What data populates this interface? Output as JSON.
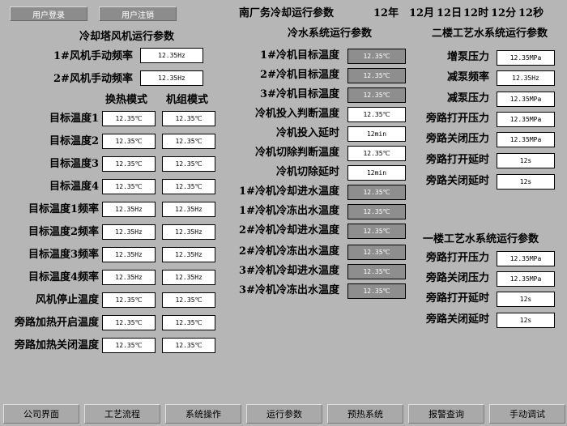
{
  "top_buttons": {
    "login": "用户登录",
    "logout": "用户注销"
  },
  "title": "南厂务冷却运行参数",
  "datetime": {
    "year": "12年",
    "month": "12月",
    "day": "12日",
    "hour": "12时",
    "minute": "12分",
    "second": "12秒"
  },
  "cooling_tower": {
    "title": "冷却塔风机运行参数",
    "fan1_label": "1#风机手动频率",
    "fan1_value": "12.35Hz",
    "fan2_label": "2#风机手动频率",
    "fan2_value": "12.35Hz",
    "col_heat": "换热模式",
    "col_unit": "机组模式",
    "rows": [
      {
        "label": "目标温度1",
        "heat": "12.35℃",
        "unit": "12.35℃"
      },
      {
        "label": "目标温度2",
        "heat": "12.35℃",
        "unit": "12.35℃"
      },
      {
        "label": "目标温度3",
        "heat": "12.35℃",
        "unit": "12.35℃"
      },
      {
        "label": "目标温度4",
        "heat": "12.35℃",
        "unit": "12.35℃"
      },
      {
        "label": "目标温度1频率",
        "heat": "12.35Hz",
        "unit": "12.35Hz"
      },
      {
        "label": "目标温度2频率",
        "heat": "12.35Hz",
        "unit": "12.35Hz"
      },
      {
        "label": "目标温度3频率",
        "heat": "12.35Hz",
        "unit": "12.35Hz"
      },
      {
        "label": "目标温度4频率",
        "heat": "12.35Hz",
        "unit": "12.35Hz"
      },
      {
        "label": "风机停止温度",
        "heat": "12.35℃",
        "unit": "12.35℃"
      },
      {
        "label": "旁路加热开启温度",
        "heat": "12.35℃",
        "unit": "12.35℃"
      },
      {
        "label": "旁路加热关闭温度",
        "heat": "12.35℃",
        "unit": "12.35℃"
      }
    ]
  },
  "chilled_water": {
    "title": "冷水系统运行参数",
    "rows": [
      {
        "label": "1#冷机目标温度",
        "value": "12.35℃"
      },
      {
        "label": "2#冷机目标温度",
        "value": "12.35℃"
      },
      {
        "label": "3#冷机目标温度",
        "value": "12.35℃"
      },
      {
        "label": "冷机投入判断温度",
        "value": "12.35℃"
      },
      {
        "label": "冷机投入延时",
        "value": "12min"
      },
      {
        "label": "冷机切除判断温度",
        "value": "12.35℃"
      },
      {
        "label": "冷机切除延时",
        "value": "12min"
      },
      {
        "label": "1#冷机冷却进水温度",
        "value": "12.35℃"
      },
      {
        "label": "1#冷机冷冻出水温度",
        "value": "12.35℃"
      },
      {
        "label": "2#冷机冷却进水温度",
        "value": "12.35℃"
      },
      {
        "label": "2#冷机冷冻出水温度",
        "value": "12.35℃"
      },
      {
        "label": "3#冷机冷却进水温度",
        "value": "12.35℃"
      },
      {
        "label": "3#冷机冷冻出水温度",
        "value": "12.35℃"
      }
    ]
  },
  "process2": {
    "title": "二楼工艺水系统运行参数",
    "rows": [
      {
        "label": "增泵压力",
        "value": "12.35MPa"
      },
      {
        "label": "减泵频率",
        "value": "12.35Hz"
      },
      {
        "label": "减泵压力",
        "value": "12.35MPa"
      },
      {
        "label": "旁路打开压力",
        "value": "12.35MPa"
      },
      {
        "label": "旁路关闭压力",
        "value": "12.35MPa"
      },
      {
        "label": "旁路打开延时",
        "value": "12s"
      },
      {
        "label": "旁路关闭延时",
        "value": "12s"
      }
    ]
  },
  "process1": {
    "title": "一楼工艺水系统运行参数",
    "rows": [
      {
        "label": "旁路打开压力",
        "value": "12.35MPa"
      },
      {
        "label": "旁路关闭压力",
        "value": "12.35MPa"
      },
      {
        "label": "旁路打开延时",
        "value": "12s"
      },
      {
        "label": "旁路关闭延时",
        "value": "12s"
      }
    ]
  },
  "nav": [
    "公司界面",
    "工艺流程",
    "系统操作",
    "运行参数",
    "预热系统",
    "报警查询",
    "手动调试"
  ]
}
